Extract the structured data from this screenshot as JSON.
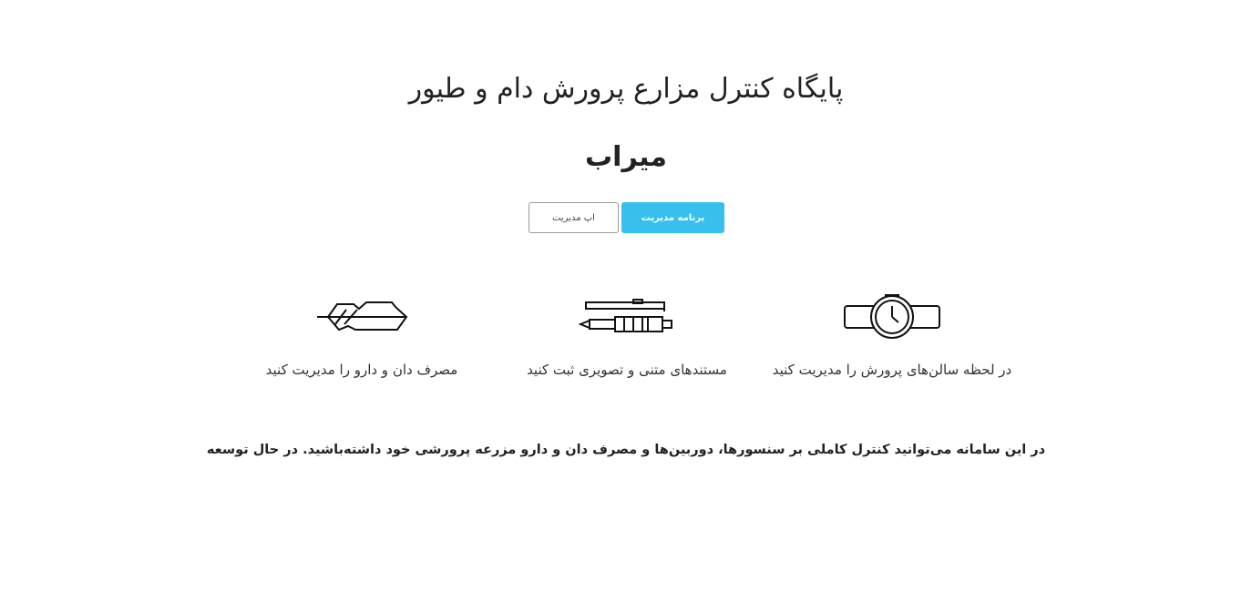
{
  "hero": {
    "title": "پایگاه کنترل مزارع پرورش دام و طیور",
    "brand": "میراب"
  },
  "buttons": {
    "primary_label": "برنامه مدیریت",
    "secondary_label": "اپ مدیریت"
  },
  "features": [
    {
      "icon": "wristwatch-icon",
      "label": "در لحظه سالن‌های پرورش را مدیریت کنید"
    },
    {
      "icon": "pen-icon",
      "label": "مستندهای متنی و تصویری ثبت کنید"
    },
    {
      "icon": "feather-icon",
      "label": "مصرف دان و دارو را مدیریت کنید"
    }
  ],
  "description": "در این سامانه می‌توانید کنترل کاملی بر سنسورها، دوربین‌ها و مصرف دان و دارو مزرعه پرورشی خود داشته‌باشید. در حال توسعه",
  "colors": {
    "accent": "#37c0ee",
    "text": "#222222",
    "outline": "#9a9a9a"
  }
}
